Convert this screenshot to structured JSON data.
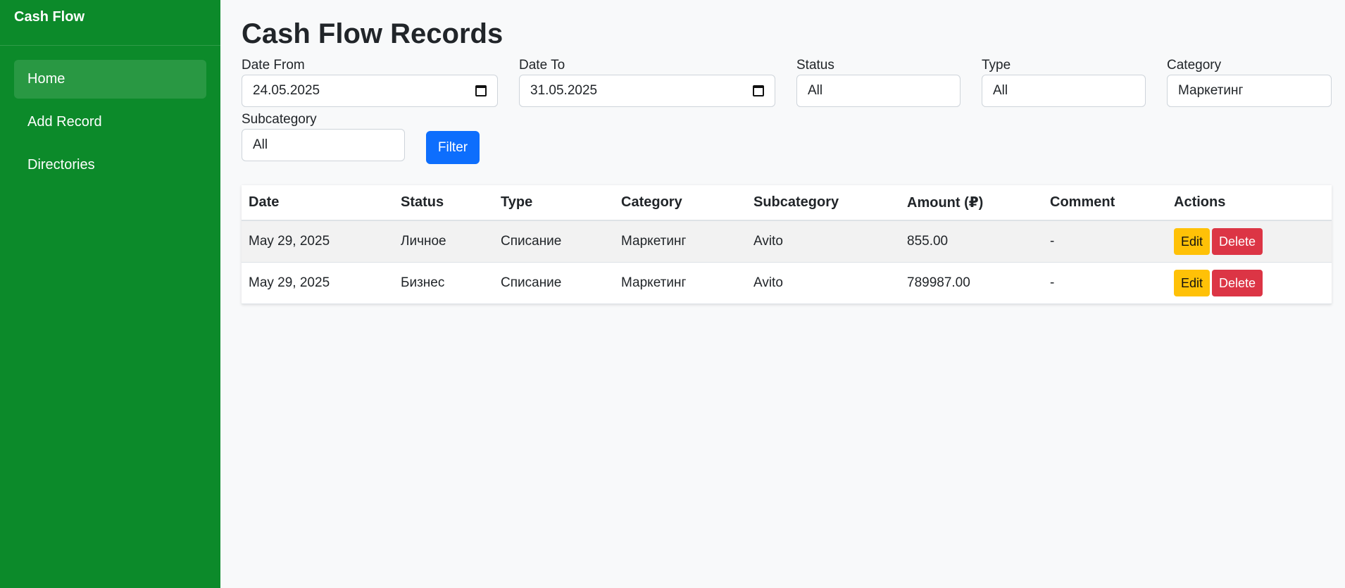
{
  "sidebar": {
    "brand": "Cash Flow",
    "items": [
      {
        "label": "Home",
        "active": true
      },
      {
        "label": "Add Record"
      },
      {
        "label": "Directories"
      }
    ]
  },
  "main": {
    "title": "Cash Flow Records",
    "filters": {
      "date_from": {
        "label": "Date From",
        "value": "24.05.2025"
      },
      "date_to": {
        "label": "Date To",
        "value": "31.05.2025"
      },
      "status": {
        "label": "Status",
        "value": "All"
      },
      "type": {
        "label": "Type",
        "value": "All"
      },
      "category": {
        "label": "Category",
        "value": "Маркетинг"
      },
      "subcategory": {
        "label": "Subcategory",
        "value": "All"
      },
      "filter_button": "Filter"
    },
    "table": {
      "columns": [
        "Date",
        "Status",
        "Type",
        "Category",
        "Subcategory",
        "Amount (₽)",
        "Comment",
        "Actions"
      ],
      "rows": [
        {
          "date": "May 29, 2025",
          "status": "Личное",
          "type": "Списание",
          "category": "Маркетинг",
          "subcategory": "Avito",
          "amount": "855.00",
          "comment": "-"
        },
        {
          "date": "May 29, 2025",
          "status": "Бизнес",
          "type": "Списание",
          "category": "Маркетинг",
          "subcategory": "Avito",
          "amount": "789987.00",
          "comment": "-"
        }
      ],
      "edit_label": "Edit",
      "delete_label": "Delete"
    }
  },
  "colors": {
    "sidebar_bg": "#0c8a2a",
    "primary": "#0d6efd",
    "edit": "#ffc107",
    "delete": "#dc3545"
  }
}
